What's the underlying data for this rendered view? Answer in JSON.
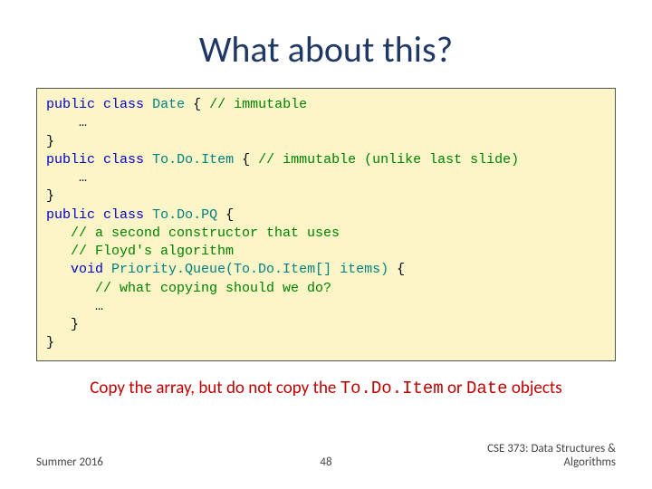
{
  "title": "What about this?",
  "code": {
    "l1a": "public",
    "l1b": "class",
    "l1c": "Date",
    "l1d": "{",
    "l1e": "// immutable",
    "l2": "    …",
    "l3": "}",
    "l4a": "public",
    "l4b": "class",
    "l4c": "To.Do.Item",
    "l4d": "{",
    "l4e": "// immutable (unlike last slide)",
    "l5": "    …",
    "l6": "}",
    "l7a": "public",
    "l7b": "class",
    "l7c": "To.Do.PQ",
    "l7d": "{",
    "l8": "   // a second constructor that uses",
    "l9": "   // Floyd's algorithm",
    "l10a": "   void",
    "l10b": "Priority.Queue(To.Do.Item[]",
    "l10c": "items)",
    "l10d": "{",
    "l11": "      // what copying should we do?",
    "l12": "      …",
    "l13": "   }",
    "l14": "}"
  },
  "answer": {
    "pre": "Copy the array, but do not copy the ",
    "m1": "To.Do.Item",
    "mid": " or ",
    "m2": "Date",
    "post": " objects"
  },
  "footer": {
    "left": "Summer 2016",
    "center": "48",
    "right": "CSE 373: Data Structures & Algorithms"
  }
}
